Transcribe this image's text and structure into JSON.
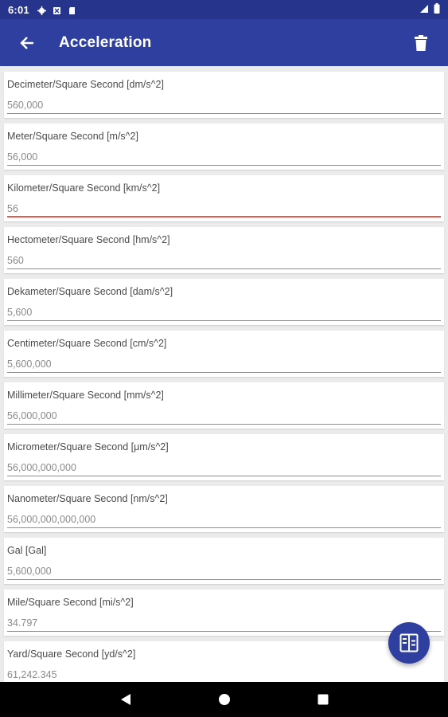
{
  "status_bar": {
    "time": "6:01",
    "icons_left": [
      "settings-icon",
      "app-notification-icon",
      "sd-card-icon"
    ],
    "icons_right": [
      "signal-icon",
      "battery-icon"
    ]
  },
  "app_bar": {
    "title": "Acceleration",
    "back_icon": "arrow-back-icon",
    "delete_icon": "trash-icon"
  },
  "colors": {
    "primary": "#2f3f9f",
    "status_bar": "#26348c",
    "focus_underline": "#e35b4e"
  },
  "units": [
    {
      "label": "Decimeter/Square Second [dm/s^2]",
      "value": "560,000"
    },
    {
      "label": "Meter/Square Second [m/s^2]",
      "value": "56,000"
    },
    {
      "label": "Kilometer/Square Second [km/s^2]",
      "value": "56",
      "focused": true
    },
    {
      "label": "Hectometer/Square Second [hm/s^2]",
      "value": "560"
    },
    {
      "label": "Dekameter/Square Second [dam/s^2]",
      "value": "5,600"
    },
    {
      "label": "Centimeter/Square Second [cm/s^2]",
      "value": "5,600,000"
    },
    {
      "label": "Millimeter/Square Second [mm/s^2]",
      "value": "56,000,000"
    },
    {
      "label": "Micrometer/Square Second [μm/s^2]",
      "value": "56,000,000,000"
    },
    {
      "label": "Nanometer/Square Second [nm/s^2]",
      "value": "56,000,000,000,000"
    },
    {
      "label": "Gal [Gal]",
      "value": "5,600,000"
    },
    {
      "label": "Mile/Square Second [mi/s^2]",
      "value": "34.797"
    },
    {
      "label": "Yard/Square Second [yd/s^2]",
      "value": "61,242.345"
    }
  ],
  "fab": {
    "icon": "compare-layout-icon"
  },
  "nav_bar": {
    "icons": [
      "back-triangle-icon",
      "home-circle-icon",
      "recents-square-icon"
    ]
  }
}
